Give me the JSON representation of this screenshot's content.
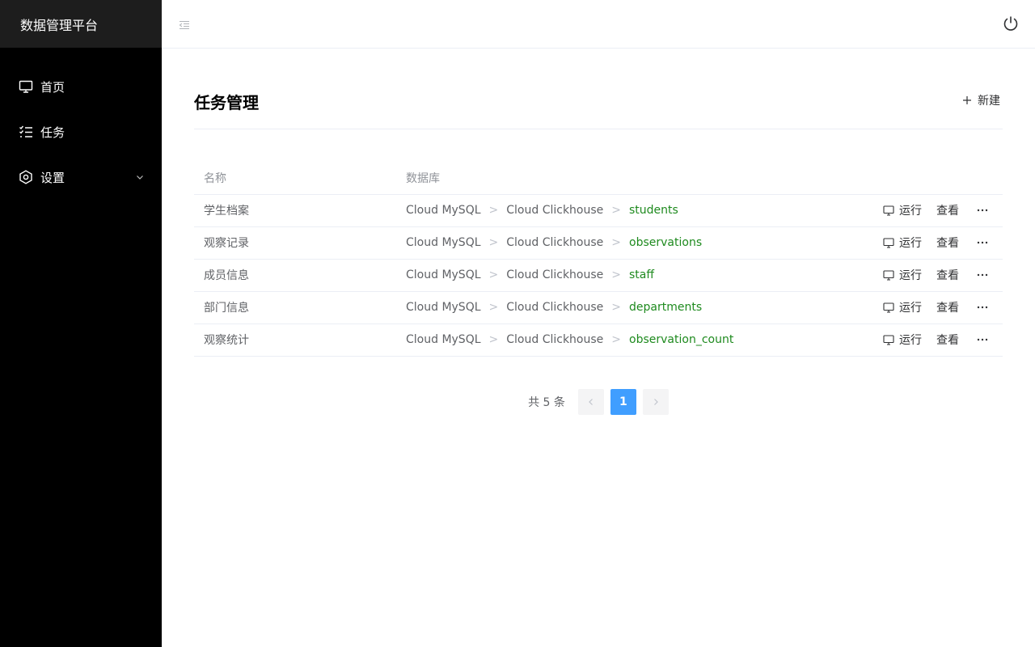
{
  "app": {
    "title": "数据管理平台"
  },
  "sidebar": {
    "items": [
      {
        "label": "首页",
        "icon": "monitor-icon"
      },
      {
        "label": "任务",
        "icon": "checklist-icon"
      },
      {
        "label": "设置",
        "icon": "settings-icon"
      }
    ]
  },
  "page": {
    "title": "任务管理",
    "new_label": "新建"
  },
  "table": {
    "headers": [
      "名称",
      "数据库"
    ],
    "rows": [
      {
        "name": "学生档案",
        "source": "Cloud MySQL",
        "middle": "Cloud Clickhouse",
        "target": "students"
      },
      {
        "name": "观察记录",
        "source": "Cloud MySQL",
        "middle": "Cloud Clickhouse",
        "target": "observations"
      },
      {
        "name": "成员信息",
        "source": "Cloud MySQL",
        "middle": "Cloud Clickhouse",
        "target": "staff"
      },
      {
        "name": "部门信息",
        "source": "Cloud MySQL",
        "middle": "Cloud Clickhouse",
        "target": "departments"
      },
      {
        "name": "观察统计",
        "source": "Cloud MySQL",
        "middle": "Cloud Clickhouse",
        "target": "observation_count"
      }
    ],
    "separator": ">",
    "actions": {
      "run": "运行",
      "view": "查看"
    }
  },
  "pagination": {
    "total_text": "共 5 条",
    "current_page": "1"
  },
  "colors": {
    "accent": "#409eff",
    "target_text": "#1e8a1e",
    "sidebar_bg": "#000000",
    "brand_bg": "#1d1d1d"
  }
}
